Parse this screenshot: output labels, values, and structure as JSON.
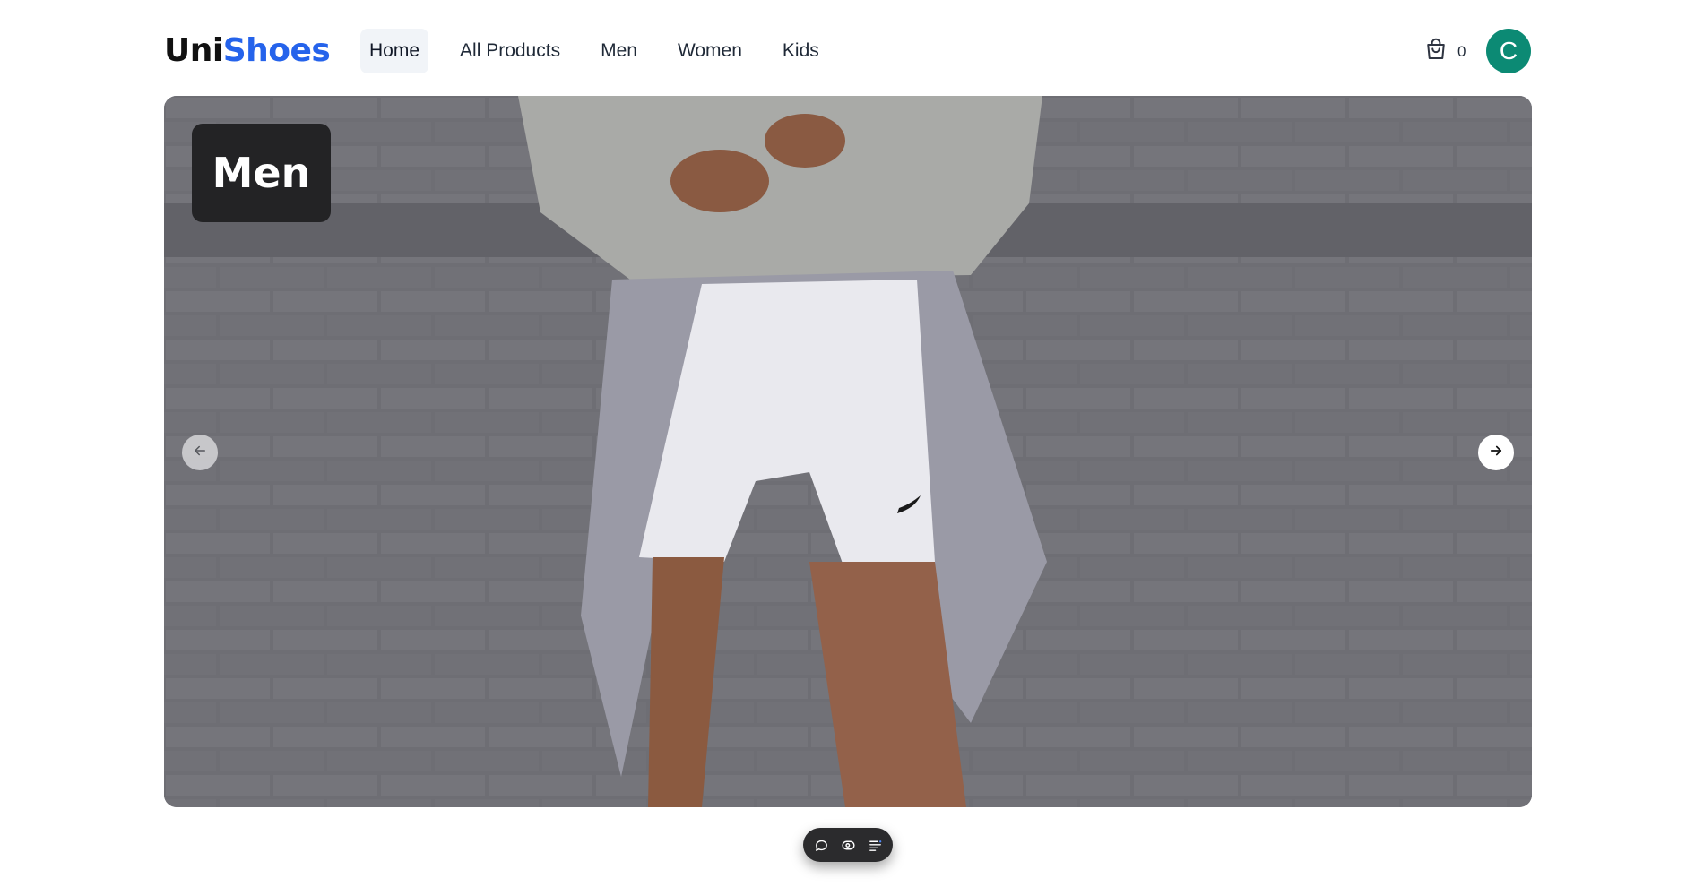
{
  "brand": {
    "part1": "Uni",
    "part2": "Shoes"
  },
  "nav": {
    "items": [
      {
        "label": "Home",
        "active": true
      },
      {
        "label": "All Products"
      },
      {
        "label": "Men"
      },
      {
        "label": "Women"
      },
      {
        "label": "Kids"
      }
    ]
  },
  "cart": {
    "icon": "shopping-bag-icon",
    "count": "0"
  },
  "user": {
    "avatar_initial": "C",
    "avatar_color": "#0c8a74"
  },
  "hero": {
    "label": "Men",
    "prev_icon": "arrow-left-icon",
    "next_icon": "arrow-right-icon"
  },
  "floating_toolbar": {
    "icons": [
      "chat-bubble-icon",
      "eye-icon",
      "list-icon"
    ]
  },
  "colors": {
    "accent": "#2563eb",
    "nav_active_bg": "#f1f4f8"
  }
}
